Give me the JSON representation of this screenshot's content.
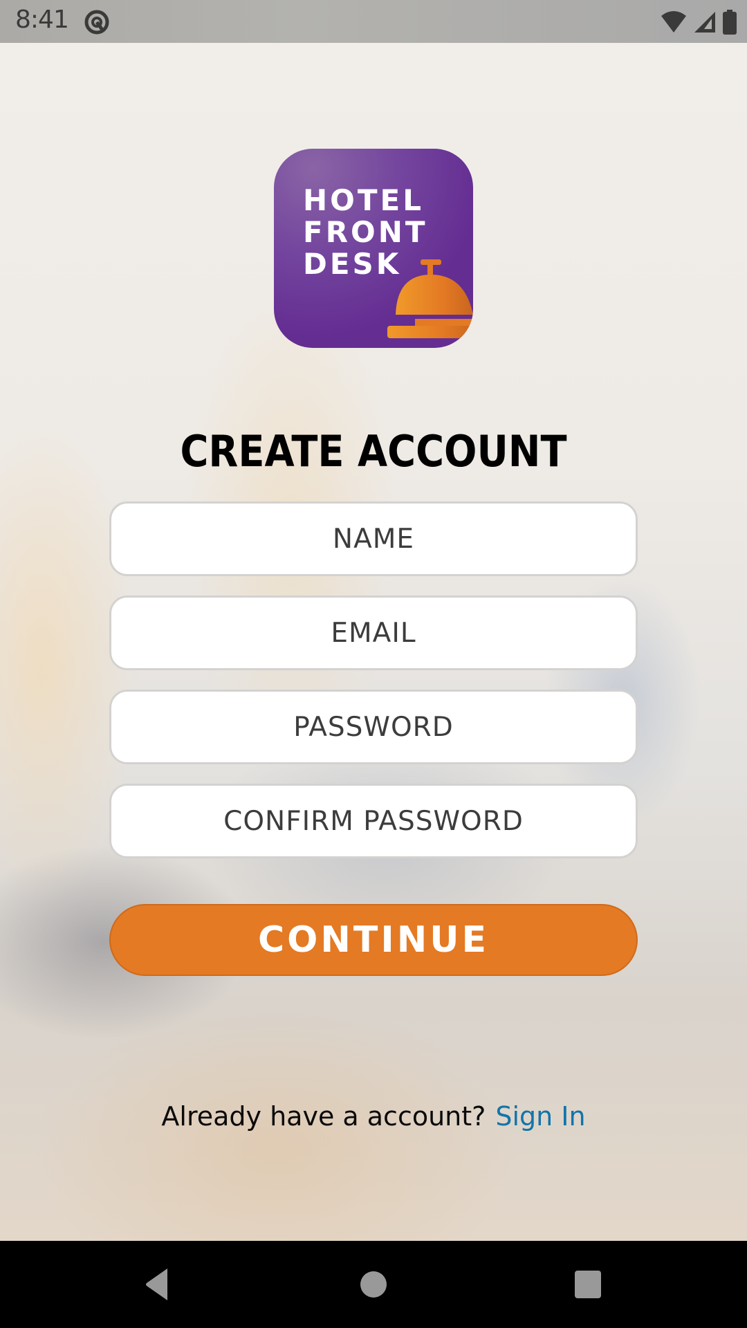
{
  "status_bar": {
    "time": "8:41",
    "icons": [
      "app-notification-icon",
      "wifi-icon",
      "cellular-signal-icon",
      "battery-icon"
    ]
  },
  "logo": {
    "lines": [
      "HOTEL",
      "FRONT",
      "DESK"
    ],
    "icon": "service-bell-icon",
    "colors": {
      "background": "#652d91",
      "bell": "#e47a24"
    }
  },
  "form": {
    "title": "CREATE ACCOUNT",
    "fields": [
      {
        "name": "name",
        "value": "",
        "placeholder": "NAME"
      },
      {
        "name": "email",
        "value": "",
        "placeholder": "EMAIL"
      },
      {
        "name": "password",
        "value": "",
        "placeholder": "PASSWORD"
      },
      {
        "name": "confirm_password",
        "value": "",
        "placeholder": "CONFIRM PASSWORD"
      }
    ],
    "continue_label": "CONTINUE"
  },
  "signin": {
    "prompt": "Already have a account?",
    "link_label": "Sign In"
  },
  "colors": {
    "accent": "#e47a24",
    "link": "#1274aa"
  },
  "nav_bar": {
    "buttons": [
      "back-icon",
      "home-icon",
      "recents-icon"
    ]
  }
}
